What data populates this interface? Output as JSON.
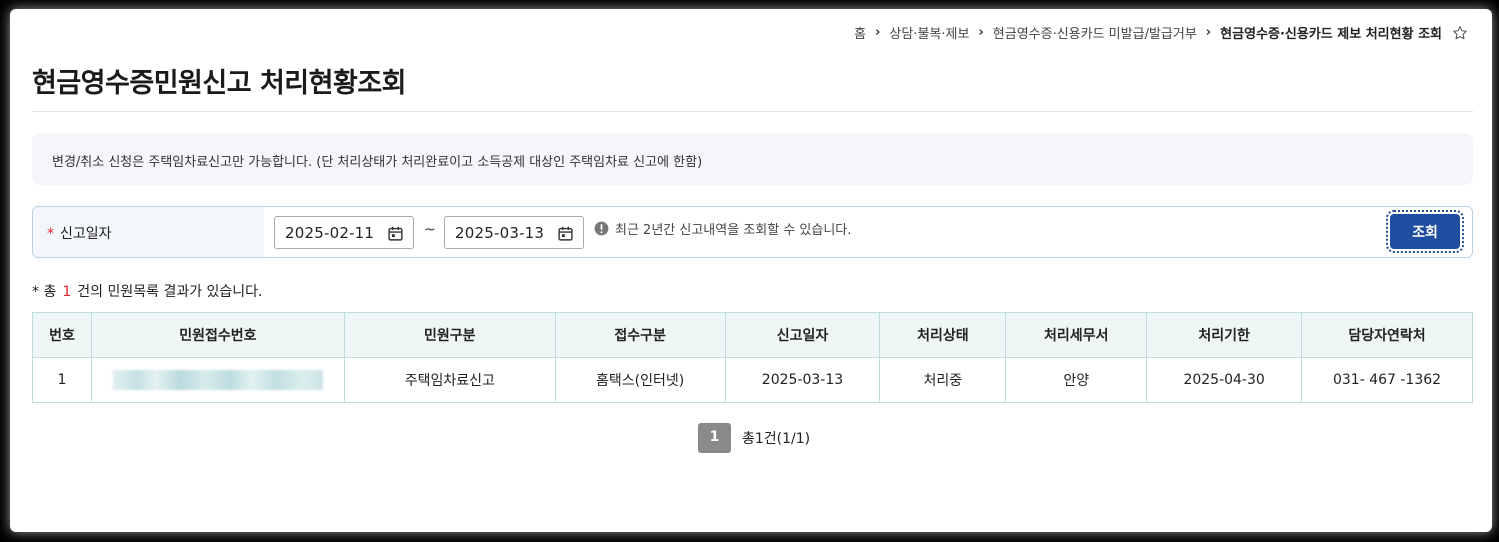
{
  "breadcrumb": {
    "items": [
      "홈",
      "상담·불복·제보",
      "현금영수증·신용카드 미발급/발급거부"
    ],
    "current": "현금영수증·신용카드 제보 처리현황 조회",
    "star_icon": "star-icon"
  },
  "page_title": "현금영수증민원신고 처리현황조회",
  "notice_text": "변경/취소 신청은 주택임차료신고만 가능합니다. (단 처리상태가 처리완료이고 소득공제 대상인 주택임차료 신고에 한함)",
  "search": {
    "required_mark": "*",
    "label": "신고일자",
    "start_date": "2025-02-11",
    "end_date": "2025-03-13",
    "range_sep": "~",
    "hint": "최근 2년간 신고내역을 조회할 수 있습니다.",
    "button_label": "조회"
  },
  "result": {
    "prefix": "* 총",
    "count": "1",
    "suffix": "건의 민원목록 결과가 있습니다."
  },
  "table": {
    "headers": [
      "번호",
      "민원접수번호",
      "민원구분",
      "접수구분",
      "신고일자",
      "처리상태",
      "처리세무서",
      "처리기한",
      "담당자연락처"
    ],
    "rows": [
      {
        "no": "1",
        "receipt_no": "",
        "category": "주택임차료신고",
        "intake": "홈택스(인터넷)",
        "report_date": "2025-03-13",
        "status": "처리중",
        "office": "안양",
        "deadline": "2025-04-30",
        "contact": "031- 467 -1362"
      }
    ]
  },
  "pagination": {
    "current_page": "1",
    "summary": "총1건(1/1)"
  },
  "colors": {
    "primary": "#1f4d9f",
    "required": "#e3242b",
    "table_header_bg": "#eef7f6",
    "table_border": "#bfdcd9"
  }
}
